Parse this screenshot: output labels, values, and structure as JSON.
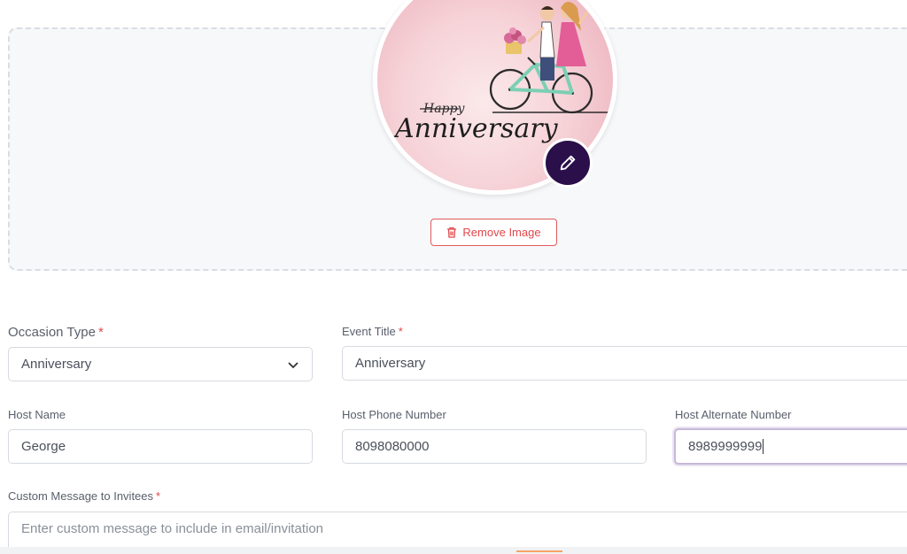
{
  "image_card": {
    "image_text_top": "Happy",
    "image_text_main": "Anniversary",
    "edit_icon": "pencil-icon",
    "remove_icon": "trash-icon",
    "remove_label": "Remove Image",
    "remove_color": "#e0474a",
    "edit_color": "#2a0f4a"
  },
  "form": {
    "occasion_type": {
      "label": "Occasion Type",
      "required": "*",
      "value": "Anniversary"
    },
    "event_title": {
      "label": "Event Title",
      "required": "*",
      "value": "Anniversary"
    },
    "host_name": {
      "label": "Host Name",
      "value": "George"
    },
    "host_phone": {
      "label": "Host Phone Number",
      "value": "8098080000"
    },
    "host_alt_phone": {
      "label": "Host Alternate Number",
      "value": "8989999999"
    },
    "custom_message": {
      "label": "Custom Message to Invitees",
      "required": "*",
      "placeholder": "Enter custom message to include in email/invitation"
    }
  }
}
